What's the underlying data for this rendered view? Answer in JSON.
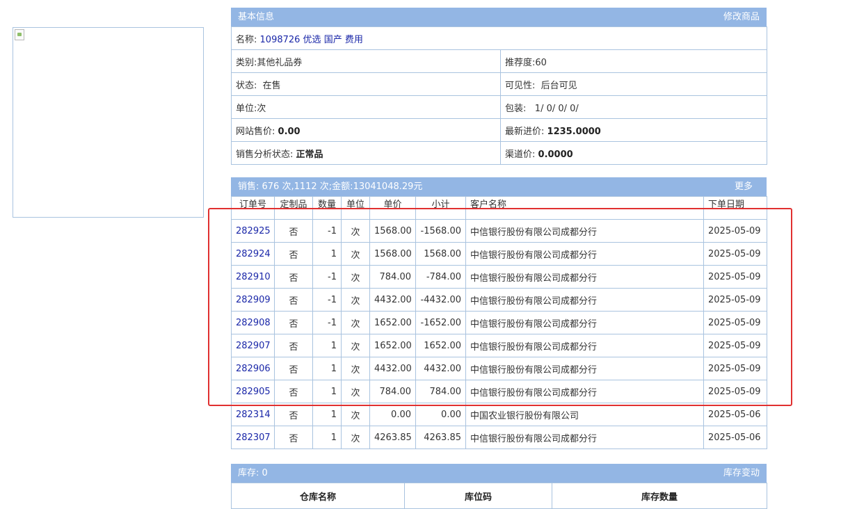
{
  "basic_info": {
    "header_title": "基本信息",
    "header_action": "修改商品",
    "name_label": "名称:",
    "name_value": "1098726 优选 国产 费用",
    "category_label": "类别:",
    "category_value": "其他礼品券",
    "recommend_label": "推荐度:",
    "recommend_value": "60",
    "status_label": "状态:",
    "status_value": "在售",
    "visibility_label": "可见性:",
    "visibility_value": "后台可见",
    "unit_label": "单位:",
    "unit_value": "次",
    "package_label": "包装:",
    "package_value": "1/ 0/ 0/ 0/",
    "site_price_label": "网站售价:",
    "site_price_value": "0.00",
    "latest_cost_label": "最新进价:",
    "latest_cost_value": "1235.0000",
    "sales_status_label": "销售分析状态:",
    "sales_status_value": "正常品",
    "channel_price_label": "渠道价:",
    "channel_price_value": "0.0000"
  },
  "sales": {
    "header_summary": "销售:  676 次,1112 次;金额:13041048.29元",
    "header_action": "更多",
    "columns": [
      "订单号",
      "定制品",
      "数量",
      "单位",
      "单价",
      "小计",
      "客户名称",
      "下单日期"
    ],
    "rows": [
      {
        "order": "282925",
        "custom": "否",
        "qty": "-1",
        "unit": "次",
        "price": "1568.00",
        "subtotal": "-1568.00",
        "customer": "中信银行股份有限公司成都分行",
        "date": "2025-05-09"
      },
      {
        "order": "282924",
        "custom": "否",
        "qty": "1",
        "unit": "次",
        "price": "1568.00",
        "subtotal": "1568.00",
        "customer": "中信银行股份有限公司成都分行",
        "date": "2025-05-09"
      },
      {
        "order": "282910",
        "custom": "否",
        "qty": "-1",
        "unit": "次",
        "price": "784.00",
        "subtotal": "-784.00",
        "customer": "中信银行股份有限公司成都分行",
        "date": "2025-05-09"
      },
      {
        "order": "282909",
        "custom": "否",
        "qty": "-1",
        "unit": "次",
        "price": "4432.00",
        "subtotal": "-4432.00",
        "customer": "中信银行股份有限公司成都分行",
        "date": "2025-05-09"
      },
      {
        "order": "282908",
        "custom": "否",
        "qty": "-1",
        "unit": "次",
        "price": "1652.00",
        "subtotal": "-1652.00",
        "customer": "中信银行股份有限公司成都分行",
        "date": "2025-05-09"
      },
      {
        "order": "282907",
        "custom": "否",
        "qty": "1",
        "unit": "次",
        "price": "1652.00",
        "subtotal": "1652.00",
        "customer": "中信银行股份有限公司成都分行",
        "date": "2025-05-09"
      },
      {
        "order": "282906",
        "custom": "否",
        "qty": "1",
        "unit": "次",
        "price": "4432.00",
        "subtotal": "4432.00",
        "customer": "中信银行股份有限公司成都分行",
        "date": "2025-05-09"
      },
      {
        "order": "282905",
        "custom": "否",
        "qty": "1",
        "unit": "次",
        "price": "784.00",
        "subtotal": "784.00",
        "customer": "中信银行股份有限公司成都分行",
        "date": "2025-05-09"
      },
      {
        "order": "282314",
        "custom": "否",
        "qty": "1",
        "unit": "次",
        "price": "0.00",
        "subtotal": "0.00",
        "customer": "中国农业银行股份有限公司",
        "date": "2025-05-06"
      },
      {
        "order": "282307",
        "custom": "否",
        "qty": "1",
        "unit": "次",
        "price": "4263.85",
        "subtotal": "4263.85",
        "customer": "中信银行股份有限公司成都分行",
        "date": "2025-05-06"
      }
    ]
  },
  "stock": {
    "header_summary": "库存:  0",
    "header_action": "库存变动",
    "columns": [
      "仓库名称",
      "库位码",
      "库存数量"
    ]
  },
  "colors": {
    "header_bg": "#93b6e4",
    "border": "#a9c3df",
    "link": "#1a27a8",
    "highlight": "#e03030"
  }
}
